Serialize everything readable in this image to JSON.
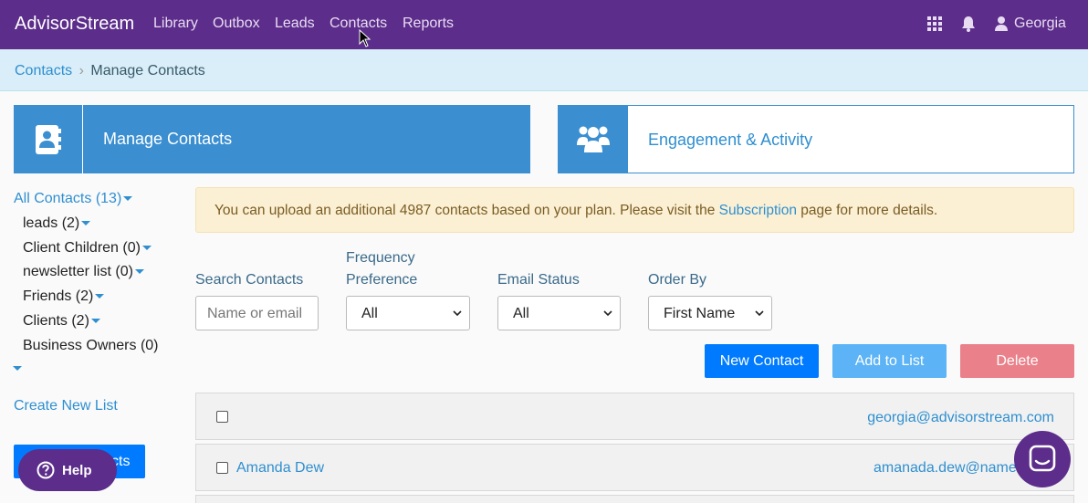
{
  "nav": {
    "brand": "AdvisorStream",
    "links": [
      "Library",
      "Outbox",
      "Leads",
      "Contacts",
      "Reports"
    ],
    "user": "Georgia"
  },
  "breadcrumb": {
    "parent": "Contacts",
    "separator": "›",
    "current": "Manage Contacts"
  },
  "cards": {
    "manage": "Manage Contacts",
    "engage": "Engagement & Activity"
  },
  "sidebar": {
    "all_contacts": "All Contacts (13)",
    "lists": [
      "leads (2)",
      "Client Children (0)",
      "newsletter list (0)",
      "Friends (2)",
      "Clients (2)",
      "Business Owners (0)"
    ],
    "create_list": "Create New List",
    "import_button_partial": "cts"
  },
  "alert": {
    "before": "You can upload an additional 4987 contacts based on your plan. Please visit the ",
    "link": "Subscription",
    "after": " page for more details."
  },
  "filters": {
    "search_label": "Search Contacts",
    "search_placeholder": "Name or email",
    "frequency_label_line1": "Frequency",
    "frequency_label_line2": "Preference",
    "frequency_value": "All",
    "email_status_label": "Email Status",
    "email_status_value": "All",
    "order_by_label": "Order By",
    "order_by_value": "First Name"
  },
  "buttons": {
    "new_contact": "New Contact",
    "add_to_list": "Add to List",
    "delete": "Delete"
  },
  "colors": {
    "nav": "#5c2d8a",
    "primary": "#007bff",
    "add_to_list": "#5cb3f5",
    "delete": "#ea808a",
    "card": "#3b8fd1"
  },
  "rows": [
    {
      "name": "",
      "email": "georgia@advisorstream.com"
    },
    {
      "name": "Amanda Dew",
      "email": "amanada.dew@names"
    }
  ],
  "help": {
    "label": "Help"
  }
}
